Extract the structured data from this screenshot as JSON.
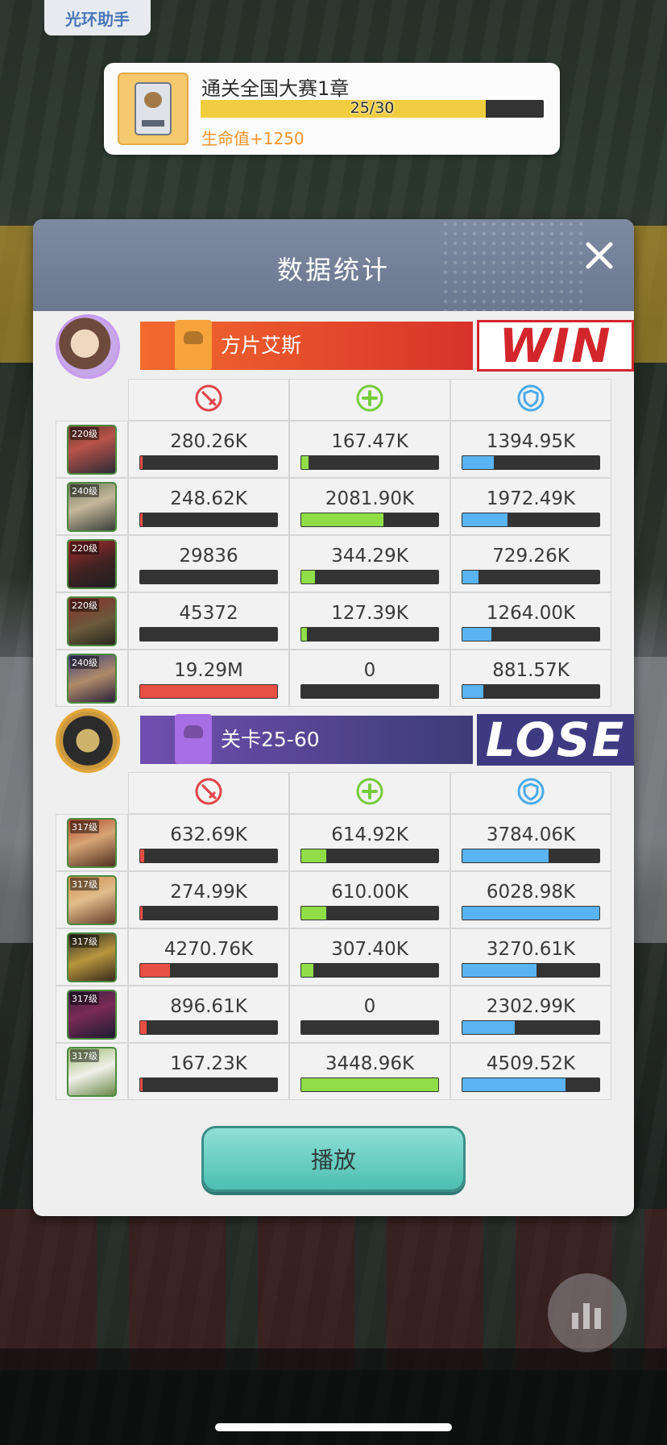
{
  "assist_button": "光环助手",
  "quest": {
    "title": "通关全国大赛1章",
    "progress_text": "25/30",
    "progress_fraction": 0.83,
    "reward": "生命值+1250"
  },
  "dialog": {
    "title": "数据统计",
    "close_icon": "close-icon"
  },
  "columns": {
    "damage_icon": "sword-icon",
    "heal_icon": "plus-icon",
    "shield_icon": "shield-icon"
  },
  "teams": [
    {
      "name": "方片艾斯",
      "result": "WIN",
      "heroes": [
        {
          "level": "220级",
          "damage": "280.26K",
          "damage_fraction": 0.015,
          "heal": "167.47K",
          "heal_fraction": 0.05,
          "shield": "1394.95K",
          "shield_fraction": 0.23
        },
        {
          "level": "240级",
          "damage": "248.62K",
          "damage_fraction": 0.013,
          "heal": "2081.90K",
          "heal_fraction": 0.6,
          "shield": "1972.49K",
          "shield_fraction": 0.33
        },
        {
          "level": "220级",
          "damage": "29836",
          "damage_fraction": 0.0,
          "heal": "344.29K",
          "heal_fraction": 0.1,
          "shield": "729.26K",
          "shield_fraction": 0.12
        },
        {
          "level": "220级",
          "damage": "45372",
          "damage_fraction": 0.0,
          "heal": "127.39K",
          "heal_fraction": 0.04,
          "shield": "1264.00K",
          "shield_fraction": 0.21
        },
        {
          "level": "240级",
          "damage": "19.29M",
          "damage_fraction": 1.0,
          "heal": "0",
          "heal_fraction": 0.0,
          "shield": "881.57K",
          "shield_fraction": 0.15
        }
      ]
    },
    {
      "name": "关卡25-60",
      "result": "LOSE",
      "heroes": [
        {
          "level": "317级",
          "damage": "632.69K",
          "damage_fraction": 0.03,
          "heal": "614.92K",
          "heal_fraction": 0.18,
          "shield": "3784.06K",
          "shield_fraction": 0.63
        },
        {
          "level": "317级",
          "damage": "274.99K",
          "damage_fraction": 0.015,
          "heal": "610.00K",
          "heal_fraction": 0.18,
          "shield": "6028.98K",
          "shield_fraction": 1.0
        },
        {
          "level": "317级",
          "damage": "4270.76K",
          "damage_fraction": 0.22,
          "heal": "307.40K",
          "heal_fraction": 0.09,
          "shield": "3270.61K",
          "shield_fraction": 0.54
        },
        {
          "level": "317级",
          "damage": "896.61K",
          "damage_fraction": 0.046,
          "heal": "0",
          "heal_fraction": 0.0,
          "shield": "2302.99K",
          "shield_fraction": 0.38
        },
        {
          "level": "317级",
          "damage": "167.23K",
          "damage_fraction": 0.01,
          "heal": "3448.96K",
          "heal_fraction": 1.0,
          "shield": "4509.52K",
          "shield_fraction": 0.75
        }
      ]
    }
  ],
  "play_button": "播放",
  "colors": {
    "damage": "#e84f45",
    "heal": "#8fde48",
    "shield": "#5ab3f2",
    "win_red": "#d3262c",
    "lose_purple": "#3e3a82"
  }
}
